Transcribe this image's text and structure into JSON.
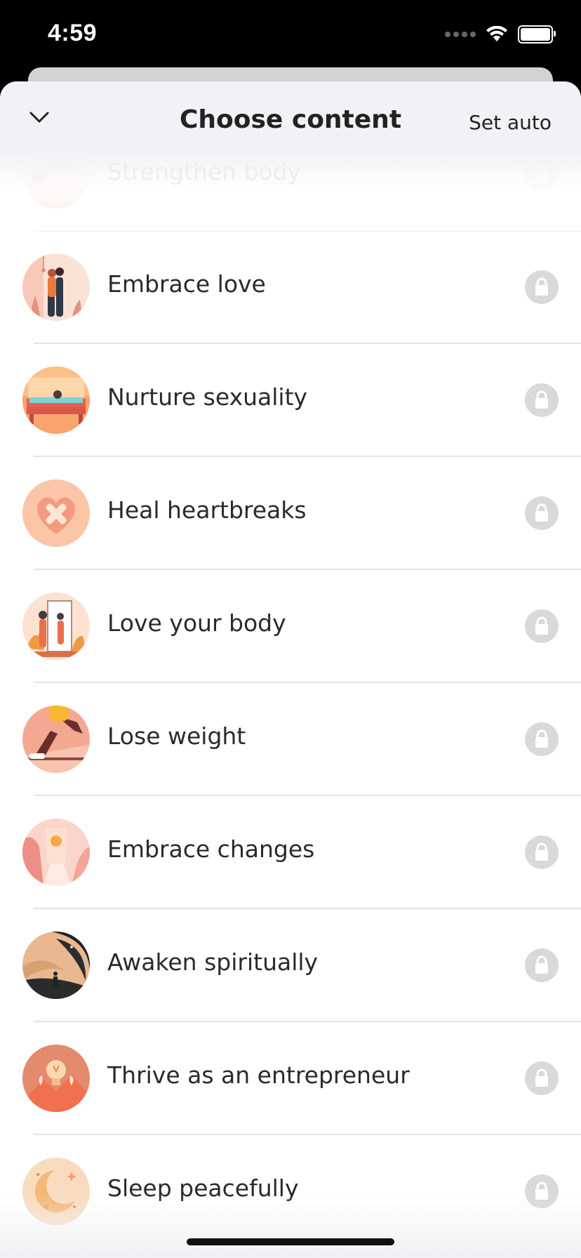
{
  "status_bar": {
    "time": "4:59"
  },
  "header": {
    "title": "Choose content",
    "set_auto_label": "Set auto"
  },
  "items": [
    {
      "label": "Strengthen body",
      "icon": "strengthen-body-thumbnail",
      "locked": true
    },
    {
      "label": "Embrace love",
      "icon": "embrace-love-thumbnail",
      "locked": true
    },
    {
      "label": "Nurture sexuality",
      "icon": "nurture-sexuality-thumbnail",
      "locked": true
    },
    {
      "label": "Heal heartbreaks",
      "icon": "heal-heartbreaks-thumbnail",
      "locked": true
    },
    {
      "label": "Love your body",
      "icon": "love-your-body-thumbnail",
      "locked": true
    },
    {
      "label": "Lose weight",
      "icon": "lose-weight-thumbnail",
      "locked": true
    },
    {
      "label": "Embrace changes",
      "icon": "embrace-changes-thumbnail",
      "locked": true
    },
    {
      "label": "Awaken spiritually",
      "icon": "awaken-spiritually-thumbnail",
      "locked": true
    },
    {
      "label": "Thrive as an entrepreneur",
      "icon": "thrive-entrepreneur-thumbnail",
      "locked": true
    },
    {
      "label": "Sleep peacefully",
      "icon": "sleep-peacefully-thumbnail",
      "locked": true
    }
  ],
  "colors": {
    "header_bg": "#f2f2f6",
    "lock_bg": "#d9d9dc",
    "divider": "#e3e3e6",
    "text": "#2a2a2a"
  }
}
